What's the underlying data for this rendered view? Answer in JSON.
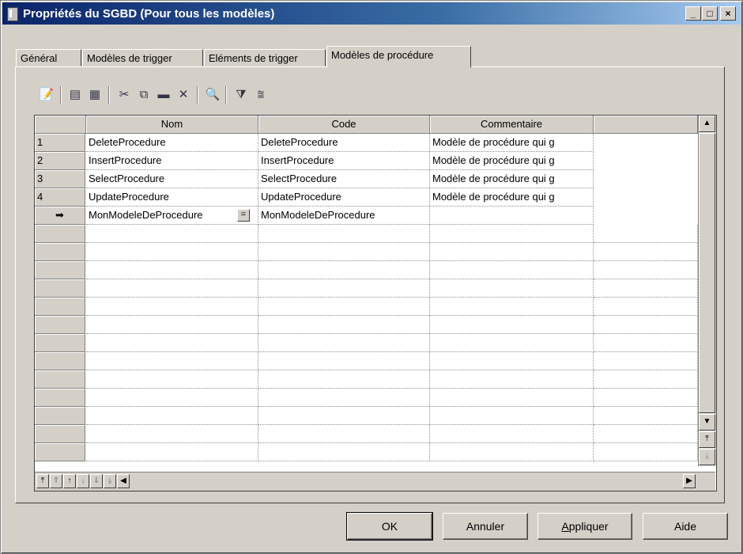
{
  "window": {
    "title": "Propriétés du SGBD (Pour tous les modèles)",
    "controls": {
      "minimize": "_",
      "maximize": "□",
      "close": "×"
    }
  },
  "tabs": [
    {
      "label": "Général",
      "active": false
    },
    {
      "label": "Modèles de trigger",
      "active": false
    },
    {
      "label": "Eléments de trigger",
      "active": false
    },
    {
      "label": "Modèles de procédure",
      "active": true
    }
  ],
  "toolbar": [
    {
      "icon": "properties-icon",
      "glyph": "📝"
    },
    {
      "icon": "insert-row-icon",
      "glyph": "▤"
    },
    {
      "icon": "add-row-icon",
      "glyph": "▦"
    },
    {
      "icon": "cut-icon",
      "glyph": "✂"
    },
    {
      "icon": "copy-icon",
      "glyph": "⧉"
    },
    {
      "icon": "paste-icon",
      "glyph": "▬"
    },
    {
      "icon": "delete-icon",
      "glyph": "✕"
    },
    {
      "icon": "find-icon",
      "glyph": "🔍"
    },
    {
      "icon": "filter-icon",
      "glyph": "⧩"
    },
    {
      "icon": "customize-columns-icon",
      "glyph": "⩰"
    }
  ],
  "grid": {
    "columns": [
      "Nom",
      "Code",
      "Commentaire",
      ""
    ],
    "rows": [
      {
        "num": "1",
        "nom": "DeleteProcedure",
        "code": "DeleteProcedure",
        "commentaire": "Modèle de procédure qui g"
      },
      {
        "num": "2",
        "nom": "InsertProcedure",
        "code": "InsertProcedure",
        "commentaire": "Modèle de procédure qui g"
      },
      {
        "num": "3",
        "nom": "SelectProcedure",
        "code": "SelectProcedure",
        "commentaire": "Modèle de procédure qui g"
      },
      {
        "num": "4",
        "nom": "UpdateProcedure",
        "code": "UpdateProcedure",
        "commentaire": "Modèle de procédure qui g"
      }
    ],
    "editing_row": {
      "marker": "➡",
      "nom": "MonModeleDeProcedure",
      "code": "MonModeleDeProcedure",
      "commentaire": "",
      "edit_button": "="
    }
  },
  "buttons": {
    "ok": "OK",
    "cancel": "Annuler",
    "apply": "Appliquer",
    "apply_underlined": "A",
    "apply_rest": "ppliquer",
    "help": "Aide"
  }
}
